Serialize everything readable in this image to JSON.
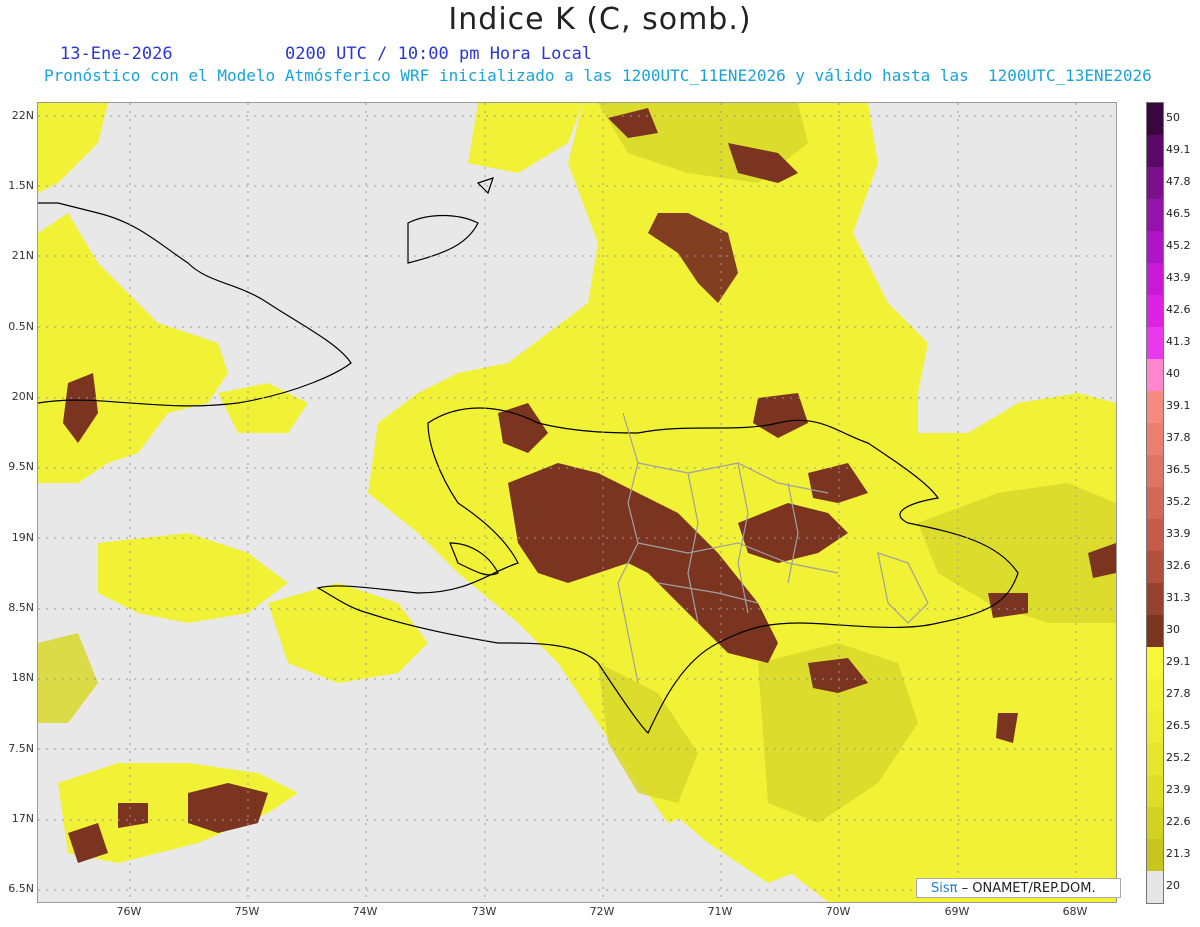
{
  "header": {
    "title": "Indice K (C, somb.)",
    "date": "13-Ene-2026",
    "time": "0200 UTC / 10:00 pm Hora Local",
    "forecast": "Pronóstico con el Modelo Atmósferico WRF inicializado a las 1200UTC_11ENE2026 y válido hasta las  1200UTC_13ENE2026"
  },
  "axes": {
    "lat_labels": [
      "22N",
      "1.5N",
      "21N",
      "0.5N",
      "20N",
      "9.5N",
      "19N",
      "8.5N",
      "18N",
      "7.5N",
      "17N",
      "6.5N"
    ],
    "lon_labels": [
      "76W",
      "75W",
      "74W",
      "73W",
      "72W",
      "71W",
      "70W",
      "69W",
      "68W"
    ]
  },
  "legend": {
    "labels": [
      "50",
      "49.1",
      "47.8",
      "46.5",
      "45.2",
      "43.9",
      "42.6",
      "41.3",
      "40",
      "39.1",
      "37.8",
      "36.5",
      "35.2",
      "33.9",
      "32.6",
      "31.3",
      "30",
      "29.1",
      "27.8",
      "26.5",
      "25.2",
      "23.9",
      "22.6",
      "21.3",
      "20"
    ],
    "colors": [
      "#3a0640",
      "#5a0a66",
      "#7a108a",
      "#9612ad",
      "#b014c8",
      "#c819d8",
      "#dc22e3",
      "#ea39ea",
      "#ff85cf",
      "#f58a82",
      "#ec7f72",
      "#e07464",
      "#d36857",
      "#c45c49",
      "#b1503c",
      "#974130",
      "#7a3420",
      "#f7f73a",
      "#f2f234",
      "#eded31",
      "#e6e62d",
      "#dede27",
      "#d2d222",
      "#c6c61c",
      "#e6e6e6"
    ]
  },
  "credit": {
    "sis": "Sisπ",
    "org": " – ONAMET/REP.DOM."
  },
  "colors": {
    "no_data": "#e8e8e8",
    "k_low": "#f3f33a",
    "k_mid": "#e4e42c",
    "k_olive": "#c9c91f",
    "k_high": "#7a3420",
    "coast": "#000000",
    "province": "#a0a0a0"
  }
}
